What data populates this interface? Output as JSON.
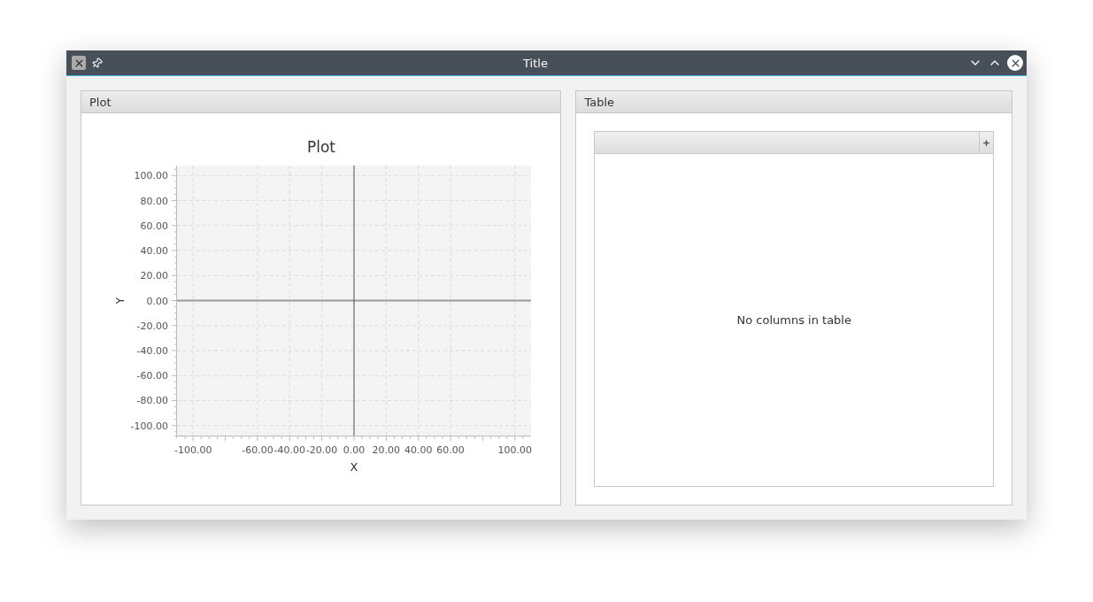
{
  "window": {
    "title": "Title"
  },
  "panels": [
    {
      "kind": "plot",
      "title": "Plot",
      "chart_data": {
        "type": "line",
        "grid": true,
        "title": "Plot",
        "xlabel": "X",
        "ylabel": "Y",
        "xlim": [
          -110,
          110
        ],
        "ylim": [
          -108,
          108
        ],
        "xticks": [
          {
            "value": -100,
            "label": "-100.00"
          },
          {
            "value": -60,
            "label": "-60.00"
          },
          {
            "value": -40,
            "label": "-40.00"
          },
          {
            "value": -20,
            "label": "-20.00"
          },
          {
            "value": 0,
            "label": "0.00"
          },
          {
            "value": 20,
            "label": "20.00"
          },
          {
            "value": 40,
            "label": "40.00"
          },
          {
            "value": 60,
            "label": "60.00"
          },
          {
            "value": 100,
            "label": "100.00"
          }
        ],
        "yticks": [
          {
            "value": 100,
            "label": "100.00"
          },
          {
            "value": 80,
            "label": "80.00"
          },
          {
            "value": 60,
            "label": "60.00"
          },
          {
            "value": 40,
            "label": "40.00"
          },
          {
            "value": 20,
            "label": "20.00"
          },
          {
            "value": 0,
            "label": "0.00"
          },
          {
            "value": -20,
            "label": "-20.00"
          },
          {
            "value": -40,
            "label": "-40.00"
          },
          {
            "value": -60,
            "label": "-60.00"
          },
          {
            "value": -80,
            "label": "-80.00"
          },
          {
            "value": -100,
            "label": "-100.00"
          }
        ]
      }
    },
    {
      "kind": "table",
      "title": "Table",
      "placeholder": "No columns in table"
    }
  ]
}
